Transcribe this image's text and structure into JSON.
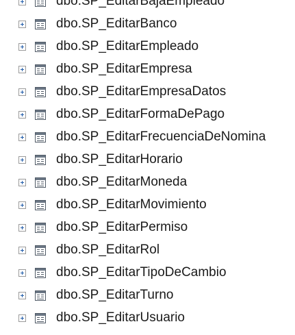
{
  "tree": {
    "items": [
      {
        "label": "dbo.SP_EditarBajaEmpleado",
        "icon": "stored-procedure-icon",
        "expand_icon": "expand-plus-icon"
      },
      {
        "label": "dbo.SP_EditarBanco",
        "icon": "stored-procedure-icon",
        "expand_icon": "expand-plus-icon"
      },
      {
        "label": "dbo.SP_EditarEmpleado",
        "icon": "stored-procedure-icon",
        "expand_icon": "expand-plus-icon"
      },
      {
        "label": "dbo.SP_EditarEmpresa",
        "icon": "stored-procedure-icon",
        "expand_icon": "expand-plus-icon"
      },
      {
        "label": "dbo.SP_EditarEmpresaDatos",
        "icon": "stored-procedure-icon",
        "expand_icon": "expand-plus-icon"
      },
      {
        "label": "dbo.SP_EditarFormaDePago",
        "icon": "stored-procedure-icon",
        "expand_icon": "expand-plus-icon"
      },
      {
        "label": "dbo.SP_EditarFrecuenciaDeNomina",
        "icon": "stored-procedure-icon",
        "expand_icon": "expand-plus-icon"
      },
      {
        "label": "dbo.SP_EditarHorario",
        "icon": "stored-procedure-icon",
        "expand_icon": "expand-plus-icon"
      },
      {
        "label": "dbo.SP_EditarMoneda",
        "icon": "stored-procedure-icon",
        "expand_icon": "expand-plus-icon"
      },
      {
        "label": "dbo.SP_EditarMovimiento",
        "icon": "stored-procedure-icon",
        "expand_icon": "expand-plus-icon"
      },
      {
        "label": "dbo.SP_EditarPermiso",
        "icon": "stored-procedure-icon",
        "expand_icon": "expand-plus-icon"
      },
      {
        "label": "dbo.SP_EditarRol",
        "icon": "stored-procedure-icon",
        "expand_icon": "expand-plus-icon"
      },
      {
        "label": "dbo.SP_EditarTipoDeCambio",
        "icon": "stored-procedure-icon",
        "expand_icon": "expand-plus-icon"
      },
      {
        "label": "dbo.SP_EditarTurno",
        "icon": "stored-procedure-icon",
        "expand_icon": "expand-plus-icon"
      },
      {
        "label": "dbo.SP_EditarUsuario",
        "icon": "stored-procedure-icon",
        "expand_icon": "expand-plus-icon"
      }
    ]
  },
  "colors": {
    "background": "#ffffff",
    "text": "#1a1a1a",
    "expander_border": "#9a9a9a",
    "expander_glyph": "#1e5aa8",
    "icon_stroke": "#505a66"
  }
}
